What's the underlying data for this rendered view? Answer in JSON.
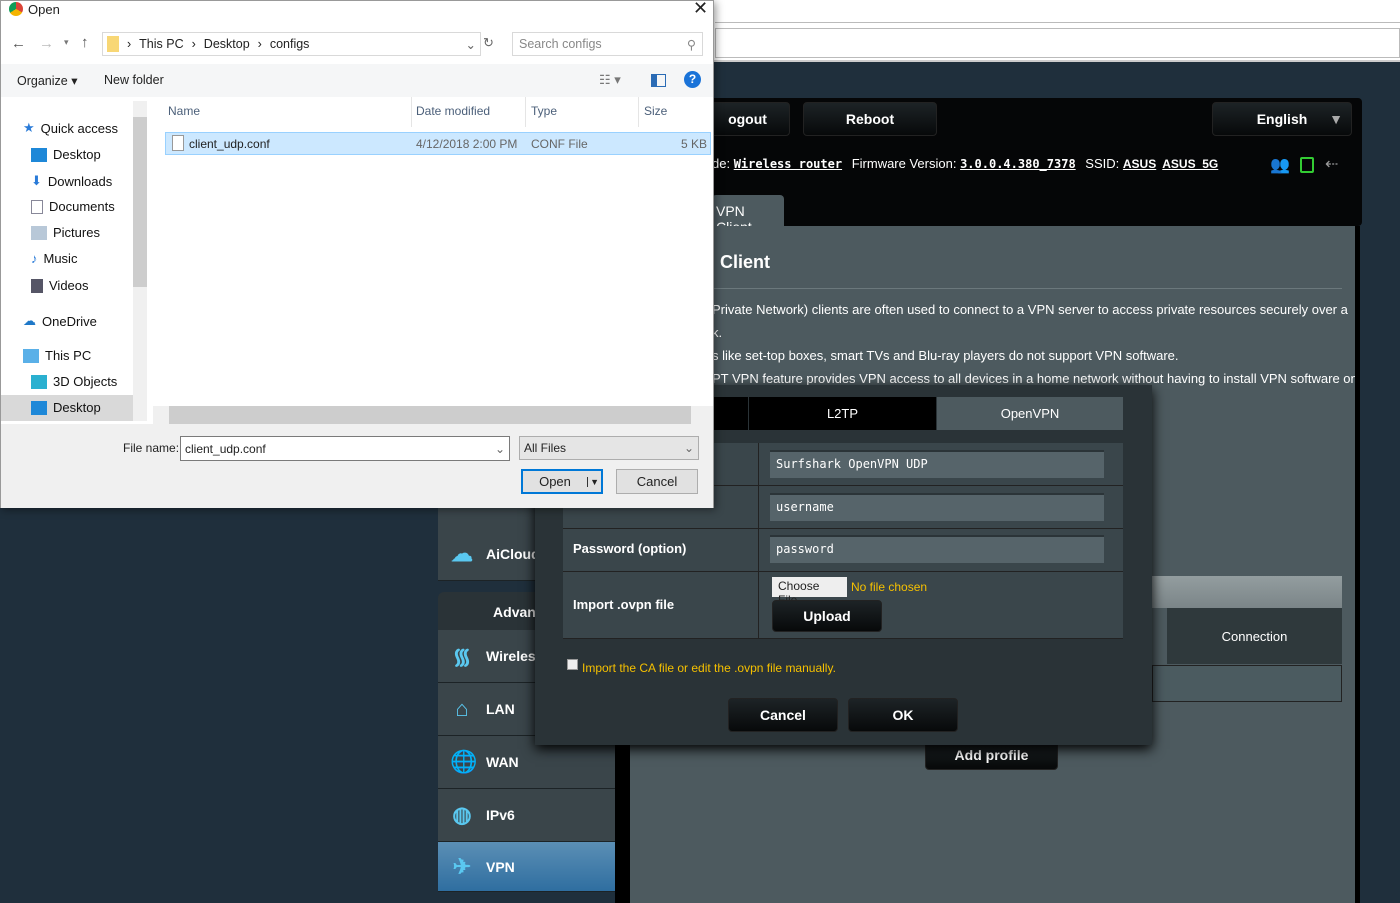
{
  "router": {
    "buttons": {
      "logout": "ogout",
      "reboot": "Reboot",
      "language": "English"
    },
    "info": {
      "mode_label": "de:",
      "mode": "Wireless router",
      "fw_label": "Firmware Version:",
      "fw": "3.0.0.4.380_7378",
      "ssid_label": "SSID:",
      "ssid1": "ASUS",
      "ssid2": "ASUS_5G"
    },
    "tab": "VPN Client",
    "title": "Client",
    "desc": [
      "Private Network) clients are often used to connect to a VPN server to access private resources securely over a",
      "k.",
      "s like set-top boxes, smart TVs and Blu-ray players do not support VPN software.",
      "PT VPN feature provides VPN access to all devices in a home network without having to install VPN software on"
    ],
    "sidebar": [
      {
        "label": "AiCloud",
        "icon": "cloud-icon"
      },
      {
        "label": "Advanced",
        "icon": ""
      },
      {
        "label": "Wireles",
        "icon": "wifi-icon"
      },
      {
        "label": "LAN",
        "icon": "home-icon"
      },
      {
        "label": "WAN",
        "icon": "globe-icon"
      },
      {
        "label": "IPv6",
        "icon": "ipv6-icon"
      },
      {
        "label": "VPN",
        "icon": "vpn-icon"
      }
    ],
    "table_header": "Connection",
    "add_profile": "Add profile"
  },
  "modal": {
    "tabs": [
      "L2TP",
      "OpenVPN"
    ],
    "description_value": "Surfshark OpenVPN UDP",
    "username_value": "username",
    "password_label": "Password (option)",
    "password_value": "password",
    "import_label": "Import .ovpn file",
    "choose_file": "Choose File",
    "no_file": "No file chosen",
    "upload": "Upload",
    "checkbox_label": "Import the CA file or edit the .ovpn file manually.",
    "cancel": "Cancel",
    "ok": "OK",
    "accent": "#f5c000"
  },
  "dialog": {
    "title": "Open",
    "breadcrumb": [
      "This PC",
      "Desktop",
      "configs"
    ],
    "search_placeholder": "Search configs",
    "organize": "Organize ▾",
    "new_folder": "New folder",
    "columns": [
      "Name",
      "Date modified",
      "Type",
      "Size"
    ],
    "files": [
      {
        "name": "client_udp.conf",
        "date": "4/12/2018 2:00 PM",
        "type": "CONF File",
        "size": "5 KB"
      }
    ],
    "nav": [
      "Quick access",
      "Desktop",
      "Downloads",
      "Documents",
      "Pictures",
      "Music",
      "Videos",
      "OneDrive",
      "This PC",
      "3D Objects",
      "Desktop"
    ],
    "filename_label": "File name:",
    "filename_value": "client_udp.conf",
    "filter": "All Files",
    "open": "Open",
    "cancel": "Cancel"
  }
}
